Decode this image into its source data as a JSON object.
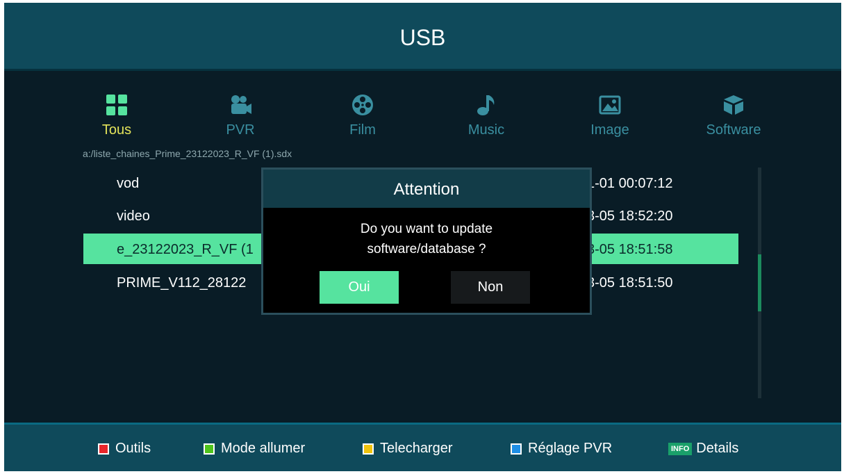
{
  "header": {
    "title": "USB"
  },
  "tabs": [
    {
      "label": "Tous",
      "icon": "grid-icon",
      "active": true
    },
    {
      "label": "PVR",
      "icon": "video-camera-icon",
      "active": false
    },
    {
      "label": "Film",
      "icon": "film-reel-icon",
      "active": false
    },
    {
      "label": "Music",
      "icon": "music-note-icon",
      "active": false
    },
    {
      "label": "Image",
      "icon": "image-icon",
      "active": false
    },
    {
      "label": "Software",
      "icon": "box-icon",
      "active": false
    }
  ],
  "path": "a:/liste_chaines_Prime_23122023_R_VF (1).sdx",
  "files": [
    {
      "name": "vod",
      "date": "1-01 00:07:12"
    },
    {
      "name": "video",
      "date": "3-05 18:52:20"
    },
    {
      "name": "e_23122023_R_VF (1",
      "date": "3-05 18:51:58"
    },
    {
      "name": "PRIME_V112_28122",
      "date": "3-05 18:51:50"
    }
  ],
  "selected_row": 2,
  "scroll": {
    "position": 0.5
  },
  "dialog": {
    "title": "Attention",
    "message_line1": "Do you want to update",
    "message_line2": "software/database ?",
    "yes_label": "Oui",
    "no_label": "Non"
  },
  "footer": {
    "items": [
      {
        "label": "Outils",
        "key_color": "#e8262b"
      },
      {
        "label": "Mode allumer",
        "key_color": "#4fc41c"
      },
      {
        "label": "Telecharger",
        "key_color": "#f0c30e"
      },
      {
        "label": "Réglage PVR",
        "key_color": "#1e8fe6"
      },
      {
        "label": "Details",
        "key_label": "INFO"
      }
    ]
  },
  "colors": {
    "background": "#091c26",
    "header": "#0f4a5b",
    "accent_green": "#56e39f",
    "active_tab": "#e3e35a",
    "inactive_tab": "#3a8fa0"
  }
}
